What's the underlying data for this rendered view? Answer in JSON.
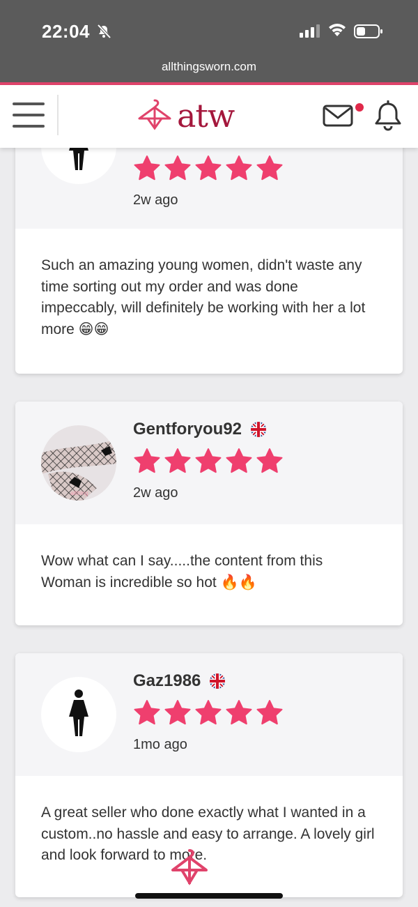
{
  "status": {
    "time": "22:04",
    "url": "allthingsworn.com"
  },
  "header": {
    "logo_text": "atw",
    "brand_color": "#a4173c",
    "accent_color": "#e0436b"
  },
  "reviews": [
    {
      "username": "",
      "flag": "",
      "rating": 5,
      "time_ago": "2w ago",
      "text": "Such an amazing young women, didn't waste any time sorting out my order and was done impeccably, will definitely be working with her a lot more 😁😁"
    },
    {
      "username": "Gentforyou92",
      "flag": "gb-flag",
      "rating": 5,
      "time_ago": "2w ago",
      "avatar_watermark": "allthing",
      "text": "Wow what can I say.....the content from this Woman is incredible so hot 🔥🔥"
    },
    {
      "username": "Gaz1986",
      "flag": "gb-flag",
      "rating": 5,
      "time_ago": "1mo ago",
      "text": "A great seller who done exactly what I wanted in a custom..no hassle and easy to arrange. A lovely girl and look forward to more."
    }
  ],
  "star_color": "#ef3f6e"
}
